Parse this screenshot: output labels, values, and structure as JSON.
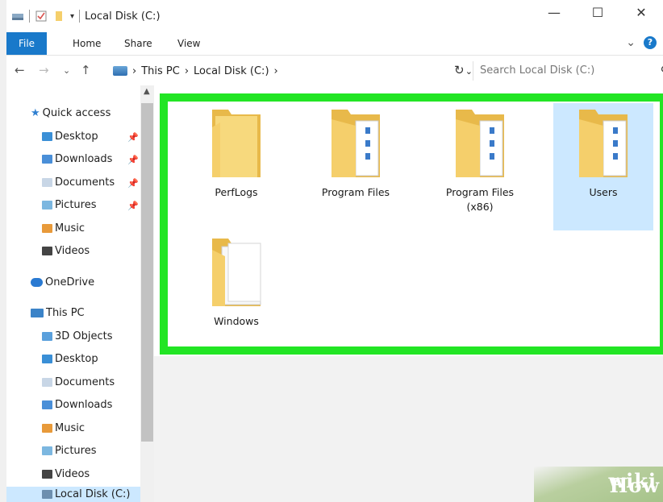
{
  "window": {
    "title": "Local Disk (C:)",
    "minimize": "—",
    "maximize": "☐",
    "close": "✕"
  },
  "ribbon": {
    "tabs": [
      "File",
      "Home",
      "Share",
      "View"
    ],
    "expand_glyph": "⌄",
    "help_glyph": "?"
  },
  "address": {
    "segments": [
      "This PC",
      "Local Disk (C:)"
    ],
    "sep": "›",
    "search_placeholder": "Search Local Disk (C:)"
  },
  "nav": {
    "quick_access": "Quick access",
    "quick_items": [
      "Desktop",
      "Downloads",
      "Documents",
      "Pictures",
      "Music",
      "Videos"
    ],
    "onedrive": "OneDrive",
    "this_pc": "This PC",
    "pc_items": [
      "3D Objects",
      "Desktop",
      "Documents",
      "Downloads",
      "Music",
      "Pictures",
      "Videos",
      "Local Disk (C:)"
    ]
  },
  "folders": [
    {
      "name": "PerfLogs",
      "selected": false
    },
    {
      "name": "Program Files",
      "selected": false
    },
    {
      "name": "Program Files (x86)",
      "selected": false
    },
    {
      "name": "Users",
      "selected": true
    },
    {
      "name": "Windows",
      "selected": false
    }
  ],
  "colors": {
    "highlight_box": "#22e524",
    "selection": "#cce8ff",
    "file_tab": "#1979ca",
    "folder": "#f5cf6b"
  },
  "watermark": {
    "part1": "wiki",
    "part2": "How"
  }
}
